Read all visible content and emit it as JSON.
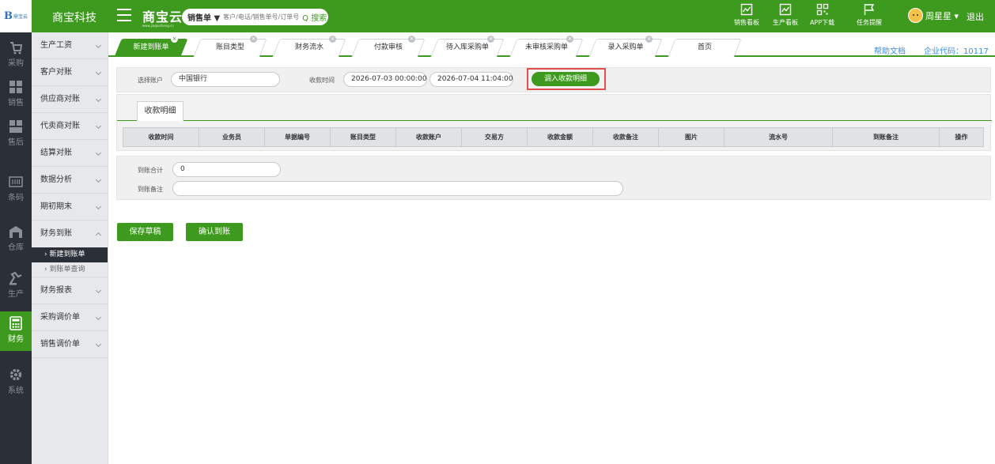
{
  "header": {
    "logo_text": "B",
    "logo_small": "鼎宝云",
    "company": "商宝科技",
    "brand_name": "商宝云",
    "brand_url": "www.jiaqiusheng.cn",
    "search_type": "销售单 ▼",
    "search_placeholder": "客户/电话/销售单号/订单号",
    "search_button": "Q 搜索",
    "tools": [
      {
        "label": "销售看板",
        "icon": "chart-board-icon"
      },
      {
        "label": "生产看板",
        "icon": "chart-board-icon"
      },
      {
        "label": "APP下载",
        "icon": "qrcode-icon"
      },
      {
        "label": "任务提醒",
        "icon": "flag-icon"
      }
    ],
    "user_name": "周星星 ▾",
    "logout": "退出"
  },
  "rail": [
    {
      "label": "采购",
      "icon": "cart-icon"
    },
    {
      "label": "销售",
      "icon": "sales-grid-icon"
    },
    {
      "label": "售后",
      "icon": "aftersale-icon"
    },
    {
      "label": "条码",
      "icon": "barcode-icon"
    },
    {
      "label": "仓库",
      "icon": "warehouse-icon"
    },
    {
      "label": "生产",
      "icon": "production-icon"
    },
    {
      "label": "财务",
      "icon": "calculator-icon",
      "active": true
    },
    {
      "label": "系统",
      "icon": "gear-icon"
    }
  ],
  "submenu": {
    "items": [
      "生产工资",
      "客户对账",
      "供应商对账",
      "代卖商对账",
      "结算对账",
      "数据分析",
      "期初期末",
      "财务到账"
    ],
    "children": [
      "› 新建到账单",
      "› 到账单查询"
    ],
    "items_after": [
      "财务报表",
      "采购调价单",
      "销售调价单"
    ]
  },
  "tabs": [
    "新建到账单",
    "账目类型",
    "财务流水",
    "付款审核",
    "待入库采购单",
    "未审核采购单",
    "录入采购单",
    "首页"
  ],
  "help_link": "帮助文档",
  "corp_code": "企业代码：10117",
  "filter": {
    "account_label": "选择账户",
    "account_value": "中国银行",
    "time_label": "收款时间",
    "time_start": "2026-07-03 00:00:00",
    "time_end": "2026-07-04 11:04:00",
    "import_button": "调入收款明细"
  },
  "detail": {
    "tab_label": "收款明细",
    "columns": [
      "收款时间",
      "业务员",
      "单据编号",
      "账目类型",
      "收款账户",
      "交易方",
      "收款金额",
      "收款备注",
      "图片",
      "流水号",
      "到账备注",
      "操作"
    ]
  },
  "summary": {
    "total_label": "到账合计",
    "total_value": "0",
    "remark_label": "到账备注",
    "remark_value": ""
  },
  "actions": {
    "save_draft": "保存草稿",
    "confirm": "确认到账"
  },
  "colors": {
    "brand_green": "#3e9a1f",
    "rail_dark": "#2a2f38",
    "highlight_red": "#e05050",
    "link_blue": "#3a8ee6"
  }
}
